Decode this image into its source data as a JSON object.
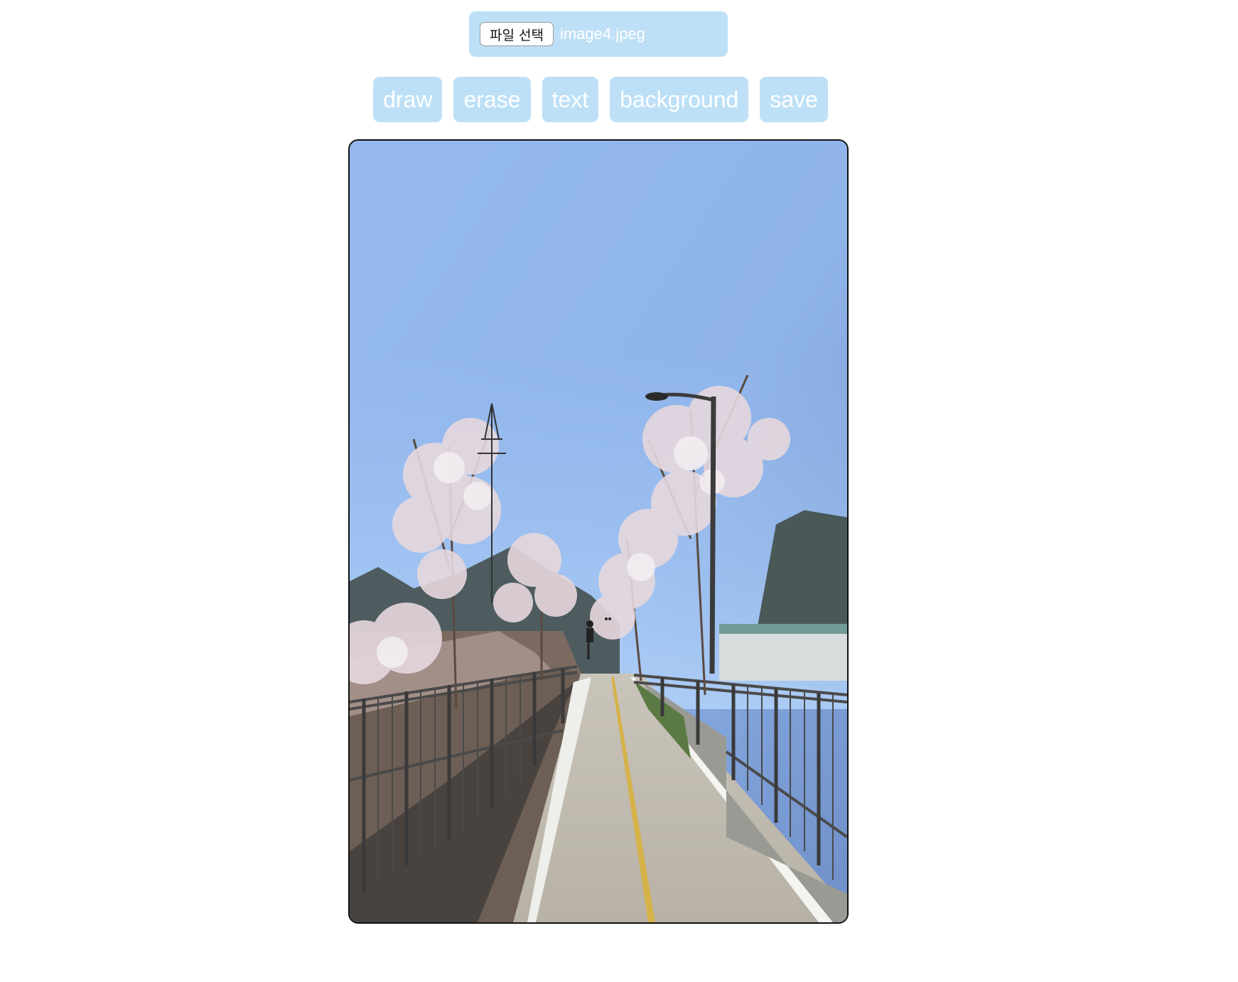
{
  "file_input": {
    "button_label": "파일 선택",
    "file_name": "image4.jpeg"
  },
  "toolbar": {
    "draw_label": "draw",
    "erase_label": "erase",
    "text_label": "text",
    "background_label": "background",
    "save_label": "save"
  },
  "colors": {
    "button_bg": "#bde0f6",
    "button_text": "#ffffff",
    "canvas_border": "#111111"
  }
}
